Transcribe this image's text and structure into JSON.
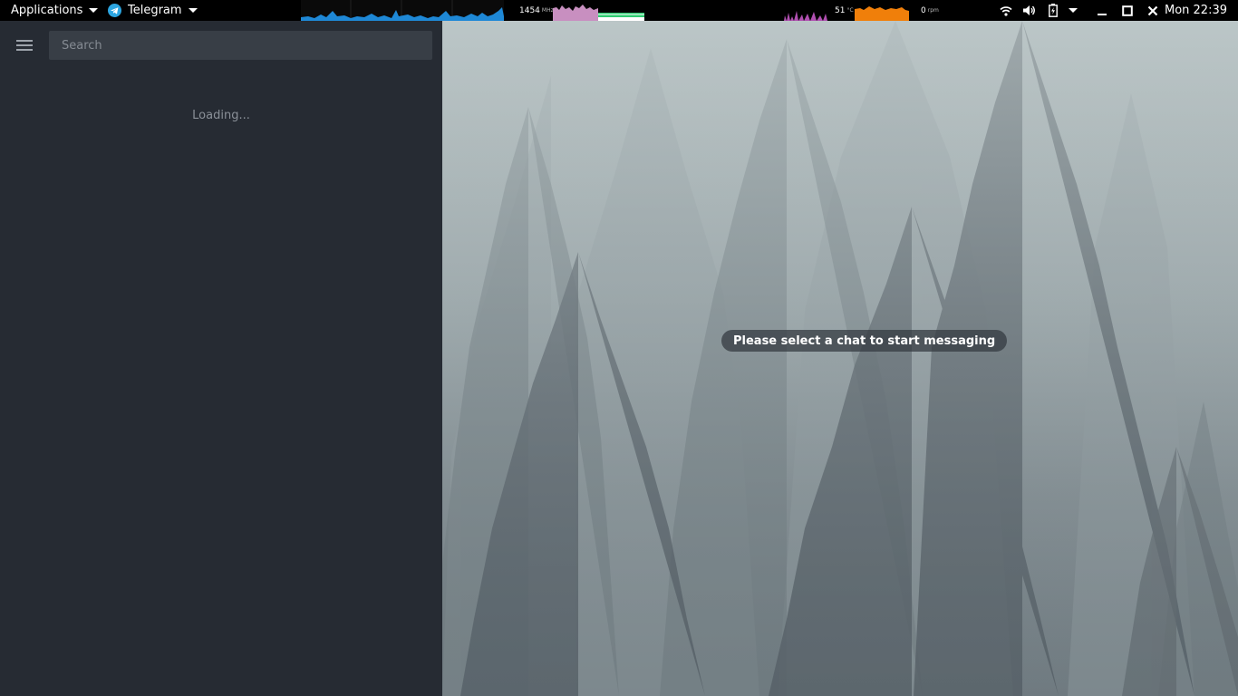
{
  "panel": {
    "applications_label": "Applications",
    "active_app_label": "Telegram",
    "cpu_freq_value": "1454",
    "cpu_freq_unit": "MHz",
    "temperature_value": "51",
    "temperature_unit": "°C",
    "fan_value": "0",
    "fan_unit": "rpm",
    "clock": "Mon 22:39",
    "colors": {
      "net_graph": "#1e88d6",
      "cpu_graph": "#c88fc0",
      "mem_bar": "#2ecc71",
      "load_graph": "#b04fb0",
      "temp_graph": "#f07f0a"
    }
  },
  "sidebar": {
    "search_placeholder": "Search",
    "loading_text": "Loading..."
  },
  "chat": {
    "empty_message": "Please select a chat to start messaging"
  }
}
